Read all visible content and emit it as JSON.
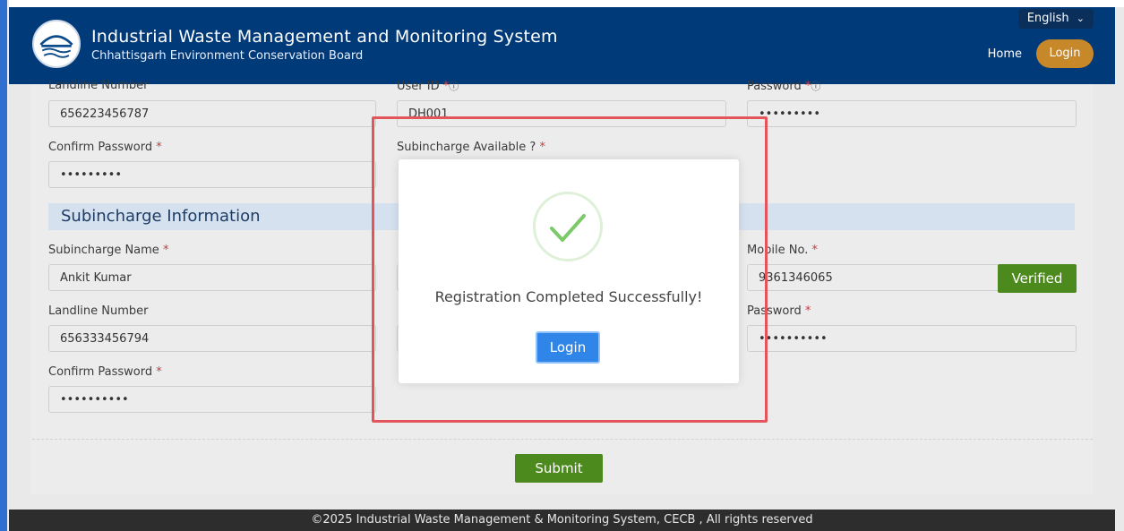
{
  "header": {
    "title": "Industrial Waste Management and Monitoring System",
    "subtitle": "Chhattisgarh Environment Conservation Board",
    "language": "English",
    "nav": {
      "home": "Home",
      "login": "Login"
    }
  },
  "form": {
    "row1": {
      "landline_label": "Landline Number",
      "landline_value": "656223456787",
      "userid_label": "User ID",
      "userid_value": "DH001",
      "password_label": "Password",
      "password_value": "•••••••••"
    },
    "row2": {
      "confirm_label": "Confirm Password",
      "confirm_value": "•••••••••",
      "subincharge_available_label": "Subincharge Available ?"
    },
    "section_title": "Subincharge Information",
    "subincharge": {
      "name_label": "Subincharge Name",
      "name_value": "Ankit Kumar",
      "mobile_label": "Mobile No.",
      "mobile_value": "9361346065",
      "verified_label": "Verified",
      "landline_label": "Landline Number",
      "landline_value": "656333456794",
      "password_label": "Password",
      "password_value": "••••••••••",
      "confirm_label": "Confirm Password",
      "confirm_value": "••••••••••"
    },
    "submit_label": "Submit"
  },
  "modal": {
    "message": "Registration Completed Successfully!",
    "login_label": "Login"
  },
  "footer": {
    "text": "©2025 Industrial Waste Management & Monitoring System, CECB , All rights reserved"
  },
  "colors": {
    "header_bg": "#003a78",
    "login_pill": "#c7882a",
    "verified_green": "#4d8a1d",
    "modal_button": "#2f86e8",
    "highlight_frame": "#e4545b"
  }
}
